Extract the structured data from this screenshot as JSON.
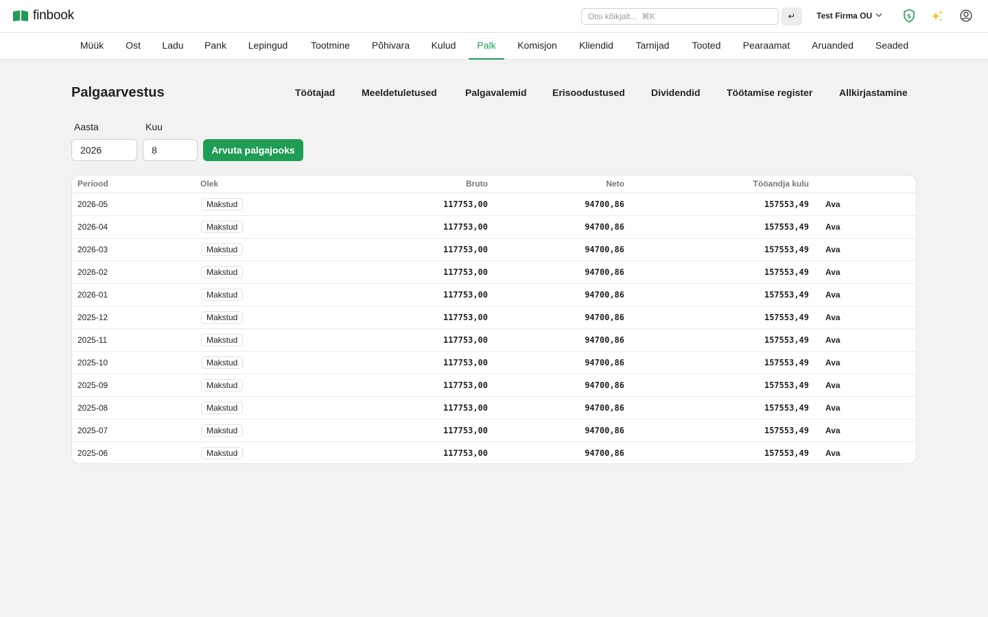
{
  "app": {
    "brand": "finbook",
    "brand_color": "#1f9d55",
    "search_placeholder": "Otsi kõikjalt...  ⌘K",
    "enter_symbol": "↵",
    "company": "Test Firma OU",
    "icons": [
      "shield-s-icon",
      "sparkles-icon",
      "user-circle-icon"
    ]
  },
  "nav": {
    "items": [
      {
        "label": "Müük"
      },
      {
        "label": "Ost"
      },
      {
        "label": "Ladu"
      },
      {
        "label": "Pank"
      },
      {
        "label": "Lepingud"
      },
      {
        "label": "Tootmine"
      },
      {
        "label": "Põhivara"
      },
      {
        "label": "Kulud"
      },
      {
        "label": "Palk",
        "active": true
      },
      {
        "label": "Komisjon"
      },
      {
        "label": "Kliendid"
      },
      {
        "label": "Tarnijad"
      },
      {
        "label": "Tooted"
      },
      {
        "label": "Pearaamat"
      },
      {
        "label": "Aruanded"
      },
      {
        "label": "Seaded"
      }
    ]
  },
  "page": {
    "title": "Palgaarvestus",
    "subnav": [
      "Töötajad",
      "Meeldetuletused",
      "Palgavalemid",
      "Erisoodustused",
      "Dividendid",
      "Töötamise register",
      "Allkirjastamine"
    ],
    "form": {
      "year_label": "Aasta",
      "year_value": "2026",
      "month_label": "Kuu",
      "month_value": "8",
      "calc_button": "Arvuta palgajooks"
    }
  },
  "table": {
    "headers": {
      "period": "Periood",
      "status": "Olek",
      "gross": "Bruto",
      "net": "Neto",
      "employer_cost": "Tööandja kulu"
    },
    "rows": [
      {
        "period": "2026-05",
        "status": "Makstud",
        "gross": "117753,00",
        "net": "94700,86",
        "employer_cost": "157553,49",
        "action": "Ava"
      },
      {
        "period": "2026-04",
        "status": "Makstud",
        "gross": "117753,00",
        "net": "94700,86",
        "employer_cost": "157553,49",
        "action": "Ava"
      },
      {
        "period": "2026-03",
        "status": "Makstud",
        "gross": "117753,00",
        "net": "94700,86",
        "employer_cost": "157553,49",
        "action": "Ava"
      },
      {
        "period": "2026-02",
        "status": "Makstud",
        "gross": "117753,00",
        "net": "94700,86",
        "employer_cost": "157553,49",
        "action": "Ava"
      },
      {
        "period": "2026-01",
        "status": "Makstud",
        "gross": "117753,00",
        "net": "94700,86",
        "employer_cost": "157553,49",
        "action": "Ava"
      },
      {
        "period": "2025-12",
        "status": "Makstud",
        "gross": "117753,00",
        "net": "94700,86",
        "employer_cost": "157553,49",
        "action": "Ava"
      },
      {
        "period": "2025-11",
        "status": "Makstud",
        "gross": "117753,00",
        "net": "94700,86",
        "employer_cost": "157553,49",
        "action": "Ava"
      },
      {
        "period": "2025-10",
        "status": "Makstud",
        "gross": "117753,00",
        "net": "94700,86",
        "employer_cost": "157553,49",
        "action": "Ava"
      },
      {
        "period": "2025-09",
        "status": "Makstud",
        "gross": "117753,00",
        "net": "94700,86",
        "employer_cost": "157553,49",
        "action": "Ava"
      },
      {
        "period": "2025-08",
        "status": "Makstud",
        "gross": "117753,00",
        "net": "94700,86",
        "employer_cost": "157553,49",
        "action": "Ava"
      },
      {
        "period": "2025-07",
        "status": "Makstud",
        "gross": "117753,00",
        "net": "94700,86",
        "employer_cost": "157553,49",
        "action": "Ava"
      },
      {
        "period": "2025-06",
        "status": "Makstud",
        "gross": "117753,00",
        "net": "94700,86",
        "employer_cost": "157553,49",
        "action": "Ava"
      }
    ]
  }
}
